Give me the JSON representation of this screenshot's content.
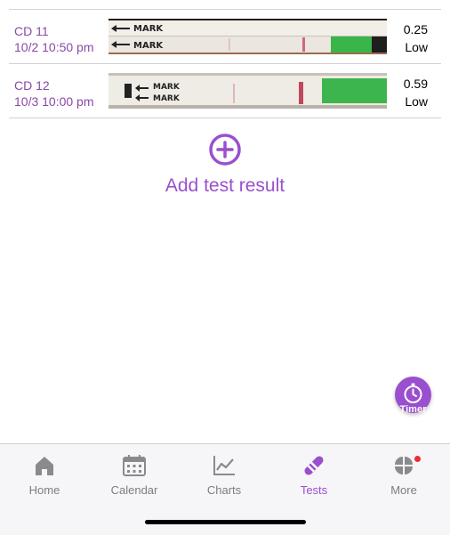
{
  "results": [
    {
      "cycle_day": "CD 11",
      "datetime": "10/2 10:50 pm",
      "value": "0.25",
      "level": "Low",
      "strip_icon": "test-strip-photo"
    },
    {
      "cycle_day": "CD 12",
      "datetime": "10/3 10:00 pm",
      "value": "0.59",
      "level": "Low",
      "strip_icon": "test-strip-photo"
    }
  ],
  "add_test": {
    "label": "Add test result",
    "icon": "plus-circle-icon"
  },
  "timer": {
    "label": "Timer",
    "icon": "stopwatch-icon"
  },
  "tabs": [
    {
      "label": "Home",
      "icon": "house-icon",
      "active": false
    },
    {
      "label": "Calendar",
      "icon": "calendar-icon",
      "active": false
    },
    {
      "label": "Charts",
      "icon": "line-chart-icon",
      "active": false
    },
    {
      "label": "Tests",
      "icon": "test-strip-icon",
      "active": true
    },
    {
      "label": "More",
      "icon": "four-petal-icon",
      "active": false,
      "badge": true
    }
  ],
  "colors": {
    "accent": "#9a4fce",
    "label_purple": "#8a48a8",
    "inactive": "#7d7d80",
    "badge": "#ee2a38"
  }
}
